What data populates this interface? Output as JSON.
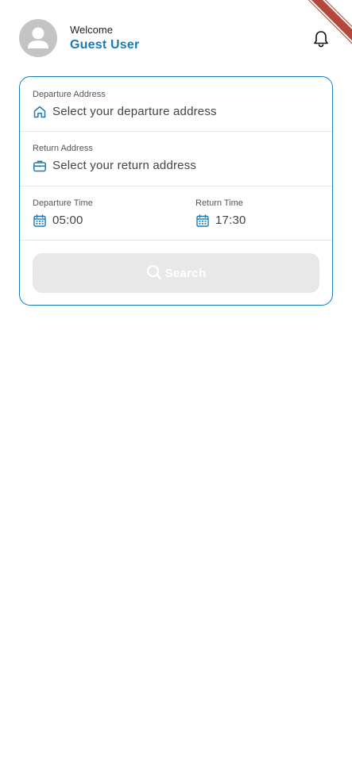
{
  "header": {
    "welcome": "Welcome",
    "user_name": "Guest User"
  },
  "form": {
    "departure_address": {
      "label": "Departure Address",
      "placeholder": "Select your departure address",
      "icon": "home-icon"
    },
    "return_address": {
      "label": "Return Address",
      "placeholder": "Select your return address",
      "icon": "briefcase-icon"
    },
    "departure_time": {
      "label": "Departure Time",
      "value": "05:00",
      "icon": "calendar-icon"
    },
    "return_time": {
      "label": "Return Time",
      "value": "17:30",
      "icon": "calendar-icon"
    },
    "search_label": "Search"
  },
  "colors": {
    "accent": "#1a7ab8",
    "button_disabled": "#e8e8e8",
    "avatar": "#c4c4c4",
    "debug_ribbon": "#b5473a"
  }
}
